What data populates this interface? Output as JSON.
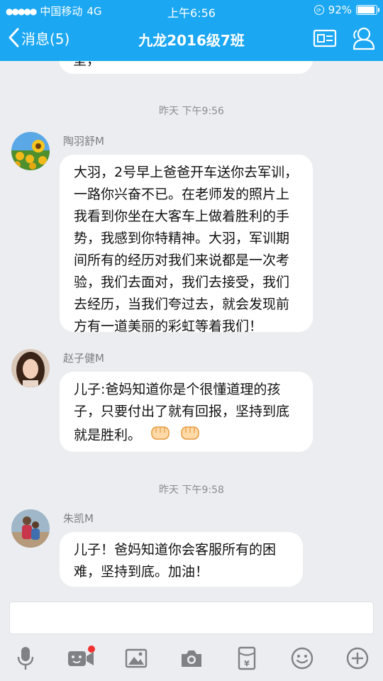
{
  "status_bar": {
    "carrier": "中国移动",
    "network": "4G",
    "time": "上午6:56",
    "battery": "92%"
  },
  "nav": {
    "back_label": "消息(5)",
    "title": "九龙2016级7班"
  },
  "messages": {
    "prev_tail": "呈，",
    "ts1": "昨天 下午9:56",
    "m1": {
      "sender": "陶羽舒M",
      "text": "大羽，2号早上爸爸开车送你去军训，一路你兴奋不已。在老师发的照片上我看到你坐在大客车上做着胜利的手势，我感到你特精神。大羽，军训期间所有的经历对我们来说都是一次考验，我们去面对，我们去接受，我们去经历，当我们夸过去，就会发现前方有一道美丽的彩虹等着我们！"
    },
    "m2": {
      "sender": "赵子健M",
      "text": "儿子:爸妈知道你是个很懂道理的孩子，只要付出了就有回报，坚持到底就是胜利。"
    },
    "ts2": "昨天 下午9:58",
    "m3": {
      "sender": "朱凯M",
      "text": "儿子！爸妈知道你会客服所有的困难，坚持到底。加油！"
    }
  },
  "colors": {
    "header_blue": "#1ba7f2",
    "background": "#ebedf0",
    "icon_gray": "#7f8185",
    "badge_red": "#f2302e"
  },
  "icons": [
    "back-chevron-icon",
    "group-card-icon",
    "group-members-icon",
    "microphone-icon",
    "video-icon",
    "image-icon",
    "camera-icon",
    "red-envelope-icon",
    "emoji-icon",
    "plus-icon",
    "fist-emoji-icon"
  ]
}
